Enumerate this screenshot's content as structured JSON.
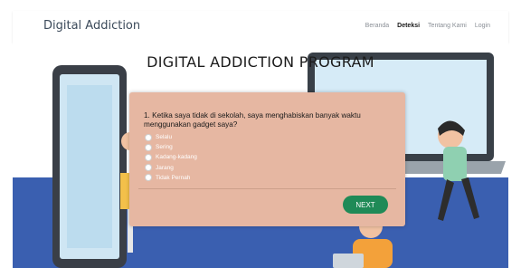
{
  "navbar": {
    "brand": "Digital Addiction",
    "links": [
      "Beranda",
      "Deteksi",
      "Tentang Kami",
      "Login"
    ],
    "active_index": 1
  },
  "hero": {
    "title": "DIGITAL ADDICTION PROGRAM"
  },
  "question_card": {
    "question": "1. Ketika saya tidak di sekolah, saya menghabiskan banyak waktu menggunakan gadget saya?",
    "options": [
      "Selalu",
      "Sering",
      "Kadang-kadang",
      "Jarang",
      "Tidak Pernah"
    ],
    "next_label": "NEXT"
  },
  "colors": {
    "card": "#e6b7a2",
    "next_button": "#1f8a57",
    "hero_floor": "#3a5fb0"
  }
}
